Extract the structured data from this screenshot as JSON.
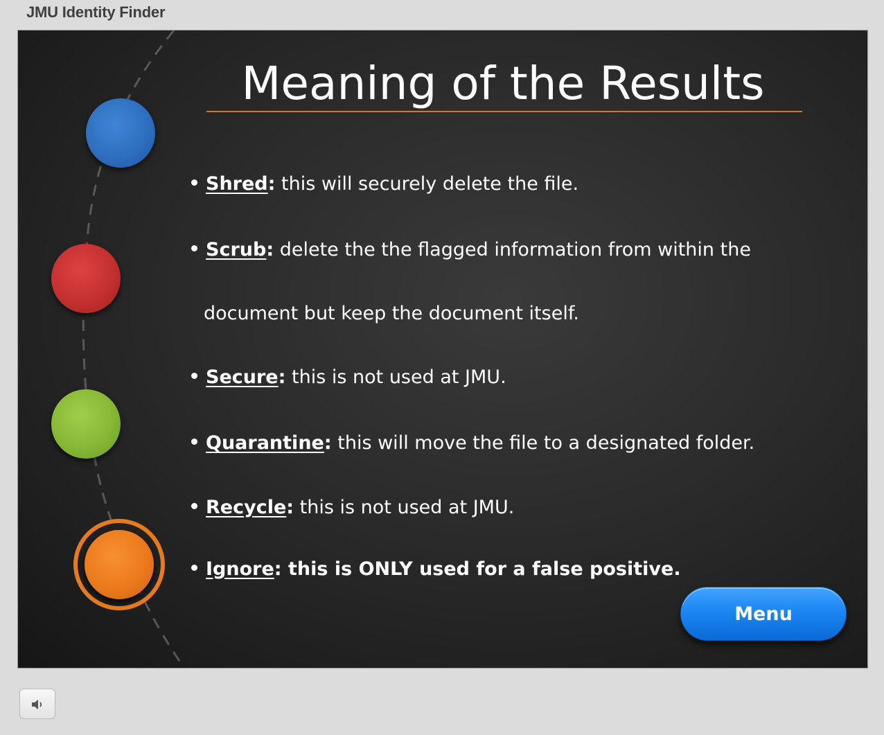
{
  "app": {
    "title": "JMU Identity Finder"
  },
  "slide": {
    "title": "Meaning of the Results",
    "items": [
      {
        "term": "Shred",
        "colon": ":",
        "description": " this will securely delete the file."
      },
      {
        "term": "Scrub",
        "colon": ":",
        "description": " delete the the flagged information from within the",
        "continuation": "document but keep the document itself."
      },
      {
        "term": "Secure",
        "colon": ":",
        "description": " this is not used at JMU."
      },
      {
        "term": "Quarantine",
        "colon": ":",
        "description": " this will move the file to a designated folder."
      },
      {
        "term": "Recycle",
        "colon": ":",
        "description": " this is not used at JMU."
      },
      {
        "term": "Ignore",
        "colon": ":",
        "description": " this is ONLY used for a false positive."
      }
    ],
    "menu_label": "Menu"
  },
  "controls": {
    "audio_icon": "speaker-icon"
  },
  "colors": {
    "accent_rule": "#d8771c",
    "blue": "#2e6fbf",
    "red": "#c43030",
    "green": "#86b836",
    "orange": "#ec7a1c",
    "menu_button": "#1c86f3"
  }
}
